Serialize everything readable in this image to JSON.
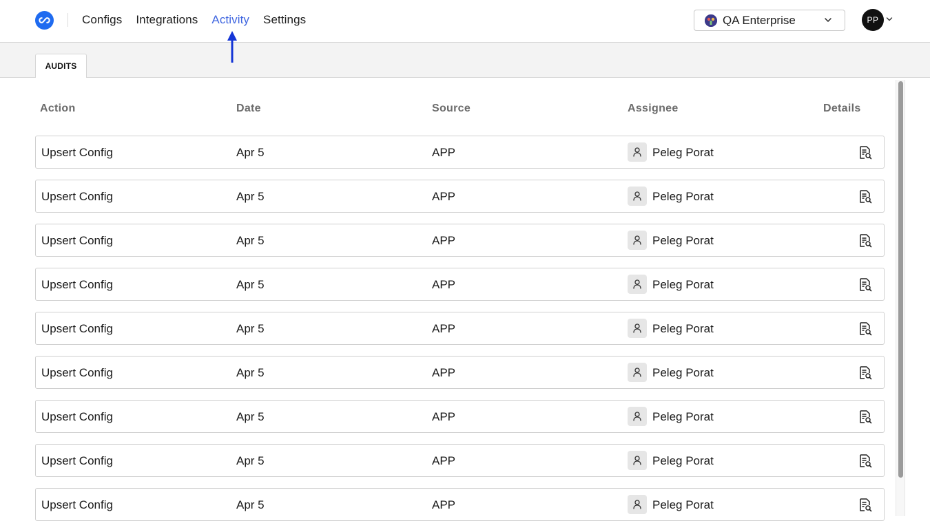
{
  "header": {
    "nav": [
      {
        "label": "Configs",
        "active": false
      },
      {
        "label": "Integrations",
        "active": false
      },
      {
        "label": "Activity",
        "active": true
      },
      {
        "label": "Settings",
        "active": false
      }
    ],
    "org_select": {
      "label": "QA Enterprise"
    },
    "avatar_initials": "PP",
    "accent_color": "#3f66e0",
    "logo_color": "#1f6bf0"
  },
  "tabs": [
    {
      "label": "AUDITS"
    }
  ],
  "table": {
    "columns": [
      "Action",
      "Date",
      "Source",
      "Assignee",
      "Details"
    ],
    "rows": [
      {
        "action": "Upsert Config",
        "date": "Apr 5",
        "source": "APP",
        "assignee": "Peleg Porat"
      },
      {
        "action": "Upsert Config",
        "date": "Apr 5",
        "source": "APP",
        "assignee": "Peleg Porat"
      },
      {
        "action": "Upsert Config",
        "date": "Apr 5",
        "source": "APP",
        "assignee": "Peleg Porat"
      },
      {
        "action": "Upsert Config",
        "date": "Apr 5",
        "source": "APP",
        "assignee": "Peleg Porat"
      },
      {
        "action": "Upsert Config",
        "date": "Apr 5",
        "source": "APP",
        "assignee": "Peleg Porat"
      },
      {
        "action": "Upsert Config",
        "date": "Apr 5",
        "source": "APP",
        "assignee": "Peleg Porat"
      },
      {
        "action": "Upsert Config",
        "date": "Apr 5",
        "source": "APP",
        "assignee": "Peleg Porat"
      },
      {
        "action": "Upsert Config",
        "date": "Apr 5",
        "source": "APP",
        "assignee": "Peleg Porat"
      },
      {
        "action": "Upsert Config",
        "date": "Apr 5",
        "source": "APP",
        "assignee": "Peleg Porat"
      }
    ]
  }
}
